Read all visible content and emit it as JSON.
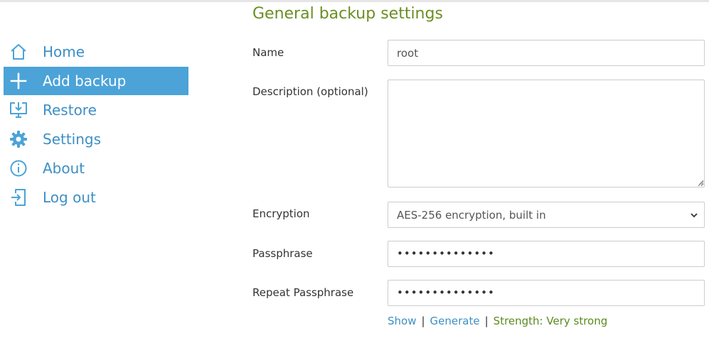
{
  "sidebar": {
    "items": [
      {
        "label": "Home",
        "icon": "home-icon",
        "active": false
      },
      {
        "label": "Add backup",
        "icon": "plus-icon",
        "active": true
      },
      {
        "label": "Restore",
        "icon": "restore-icon",
        "active": false
      },
      {
        "label": "Settings",
        "icon": "gear-icon",
        "active": false
      },
      {
        "label": "About",
        "icon": "info-icon",
        "active": false
      },
      {
        "label": "Log out",
        "icon": "logout-icon",
        "active": false
      }
    ]
  },
  "main": {
    "title": "General backup settings",
    "name": {
      "label": "Name",
      "value": "root"
    },
    "description": {
      "label": "Description (optional)",
      "value": ""
    },
    "encryption": {
      "label": "Encryption",
      "selected": "AES-256 encryption, built in"
    },
    "passphrase": {
      "label": "Passphrase",
      "value": "••••••••••••••"
    },
    "repeat_passphrase": {
      "label": "Repeat Passphrase",
      "value": "••••••••••••••"
    },
    "links": {
      "show": "Show",
      "separator": "|",
      "generate": "Generate",
      "strength": "Strength: Very strong"
    }
  },
  "colors": {
    "accent": "#4ba3d8",
    "link": "#3d8fc6",
    "title": "#6b8e23",
    "strength": "#5a8a1e"
  }
}
